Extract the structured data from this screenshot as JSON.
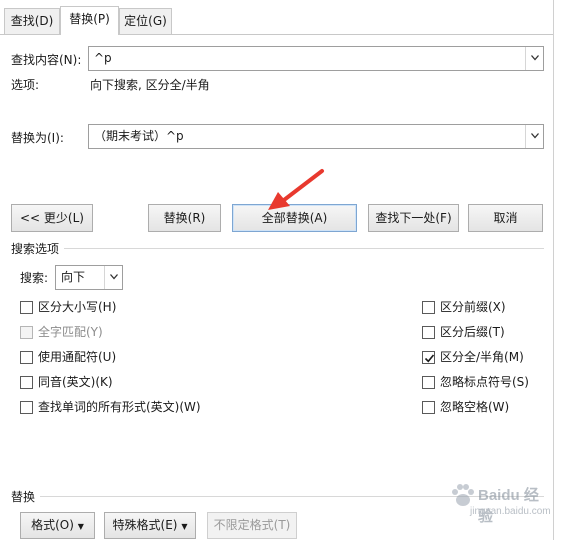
{
  "tabs": [
    {
      "label": "查找(D)"
    },
    {
      "label": "替换(P)"
    },
    {
      "label": "定位(G)"
    }
  ],
  "find": {
    "label": "查找内容(N):",
    "value": "^p"
  },
  "options": {
    "label": "选项:",
    "value": "向下搜索, 区分全/半角"
  },
  "replace": {
    "label": "替换为(I):",
    "value": "（期末考试）^p"
  },
  "buttons": {
    "less": "<< 更少(L)",
    "replace": "替换(R)",
    "replace_all": "全部替换(A)",
    "find_next": "查找下一处(F)",
    "cancel": "取消"
  },
  "search_options": {
    "title": "搜索选项",
    "search_label": "搜索:",
    "search_value": "向下"
  },
  "left_checks": [
    {
      "label": "区分大小写(H)",
      "checked": false,
      "disabled": false
    },
    {
      "label": "全字匹配(Y)",
      "checked": false,
      "disabled": true
    },
    {
      "label": "使用通配符(U)",
      "checked": false,
      "disabled": false
    },
    {
      "label": "同音(英文)(K)",
      "checked": false,
      "disabled": false
    },
    {
      "label": "查找单词的所有形式(英文)(W)",
      "checked": false,
      "disabled": false
    }
  ],
  "right_checks": [
    {
      "label": "区分前缀(X)",
      "checked": false
    },
    {
      "label": "区分后缀(T)",
      "checked": false
    },
    {
      "label": "区分全/半角(M)",
      "checked": true
    },
    {
      "label": "忽略标点符号(S)",
      "checked": false
    },
    {
      "label": "忽略空格(W)",
      "checked": false
    }
  ],
  "replace_section": {
    "title": "替换",
    "format": "格式(O)",
    "special": "特殊格式(E)",
    "no_format": "不限定格式(T)"
  },
  "watermark": {
    "text": "Baidu 经验",
    "url": "jingyan.baidu.com"
  },
  "colors": {
    "arrow": "#e8392e",
    "focus": "#7ea6d2"
  }
}
